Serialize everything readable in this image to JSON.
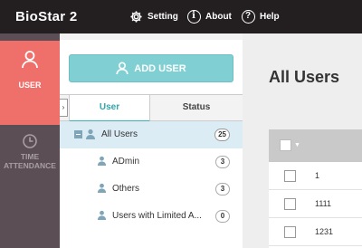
{
  "header": {
    "brand": "BioStar 2",
    "nav": [
      {
        "label": "Setting",
        "icon": "gear-icon"
      },
      {
        "label": "About",
        "icon": "info-icon"
      },
      {
        "label": "Help",
        "icon": "help-icon"
      }
    ]
  },
  "sidebar": {
    "items": [
      {
        "label": "USER",
        "icon": "user-icon",
        "active": true
      },
      {
        "label": "TIME ATTENDANCE",
        "label_lines": [
          "TIME",
          "ATTENDANCE"
        ],
        "icon": "clock-icon",
        "active": false
      }
    ]
  },
  "panel": {
    "add_user_label": "ADD USER",
    "tabs": [
      {
        "label": "User",
        "active": true
      },
      {
        "label": "Status",
        "active": false
      }
    ],
    "tree": [
      {
        "label": "All Users",
        "count": "25",
        "selected": true
      },
      {
        "label": "ADmin",
        "count": "3"
      },
      {
        "label": "Others",
        "count": "3"
      },
      {
        "label": "Users with Limited A...",
        "count": "0"
      }
    ]
  },
  "main": {
    "title": "All Users",
    "rows": [
      {
        "id": "1"
      },
      {
        "id": "1111"
      },
      {
        "id": "1231"
      }
    ]
  },
  "colors": {
    "topbar": "#231f20",
    "sidebar": "#5b4e54",
    "sidebar_active": "#ef6f6a",
    "accent": "#7fcfd3",
    "tab_active_text": "#2fa6ab",
    "tree_selected": "#dcecf5",
    "grid_header": "#c9c9c9"
  }
}
